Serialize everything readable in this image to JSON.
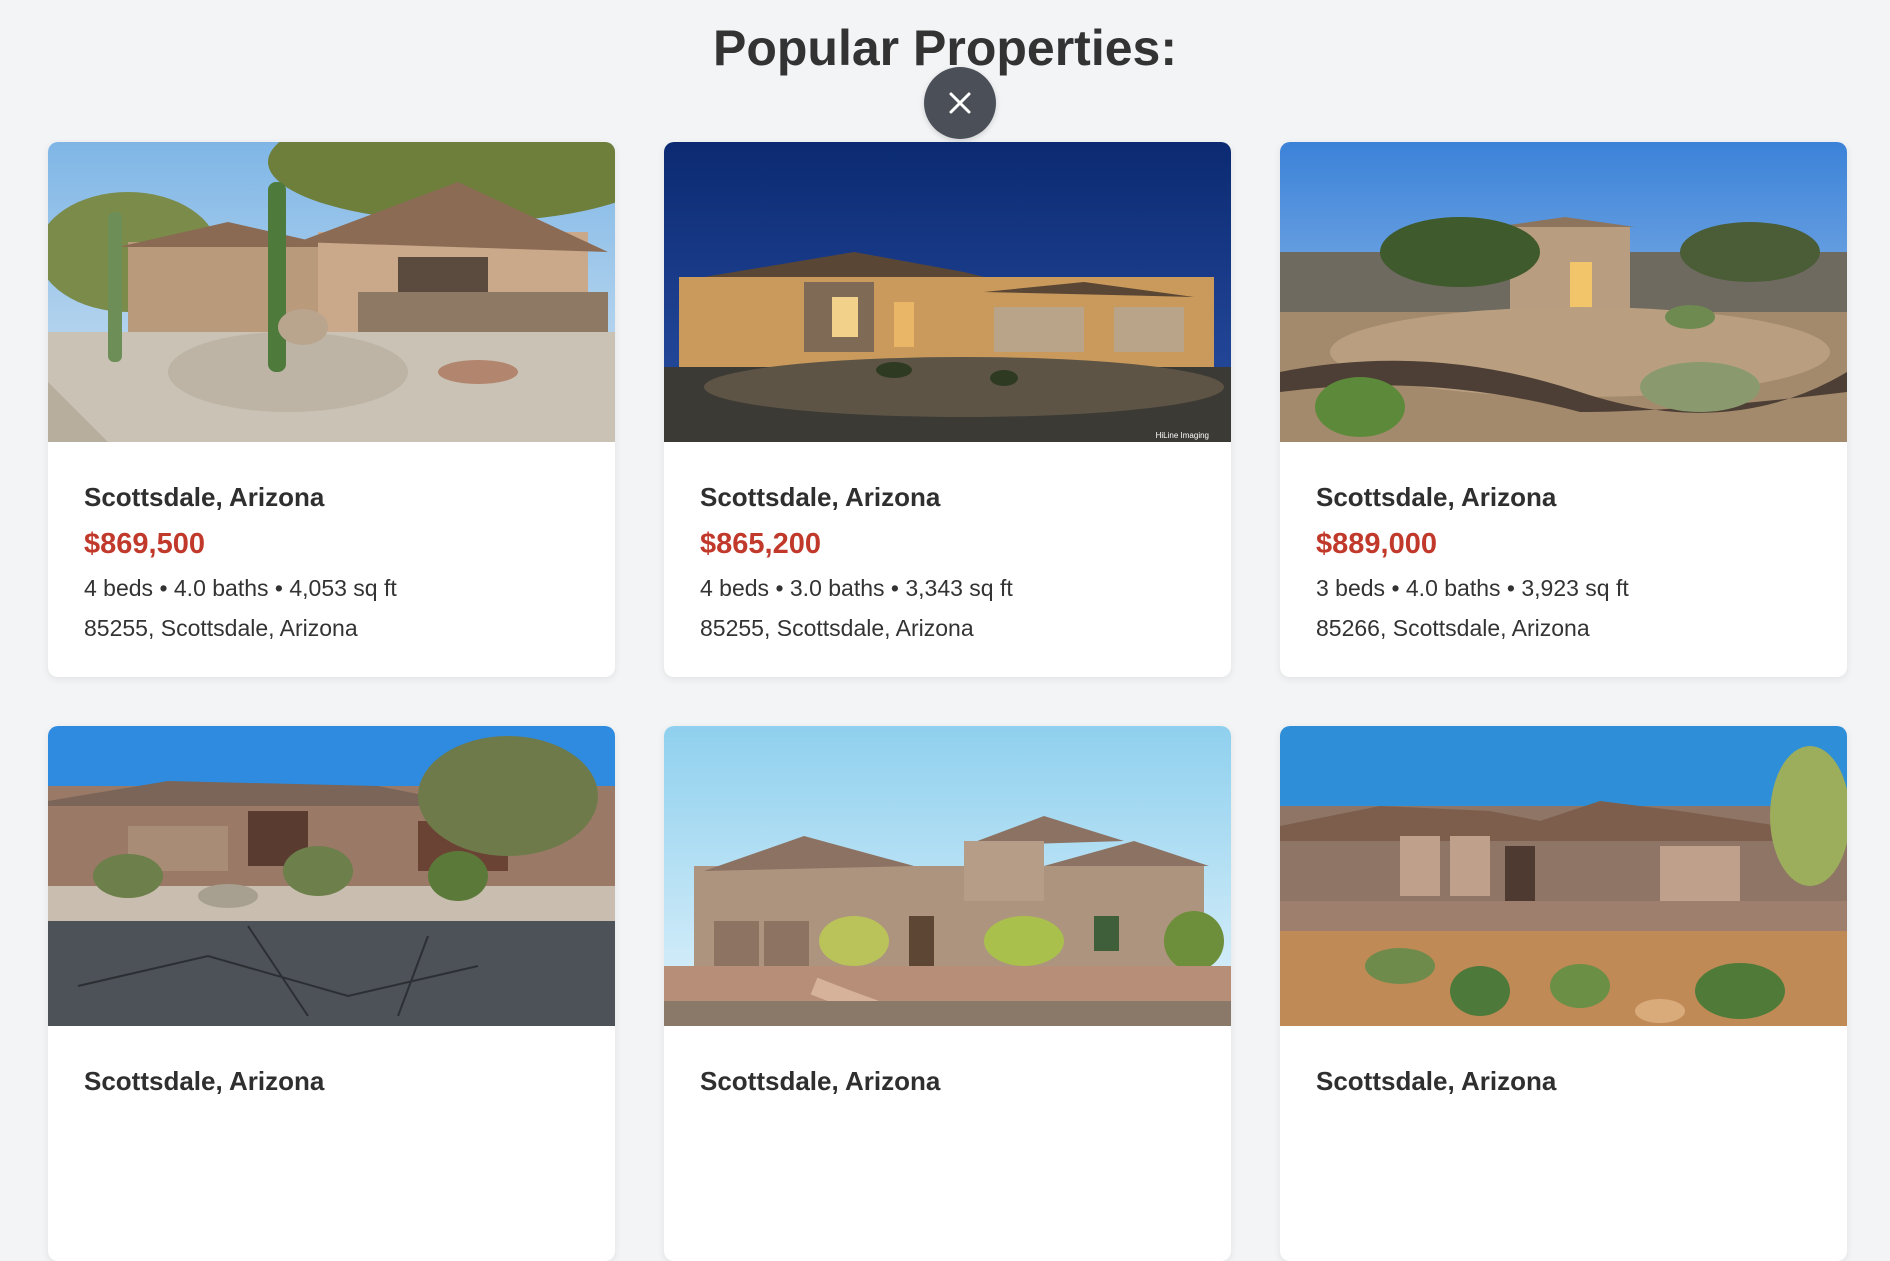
{
  "page": {
    "title": "Popular Properties:"
  },
  "close_button": {
    "icon": "close-icon"
  },
  "colors": {
    "background": "#f3f4f6",
    "price": "#c0392b",
    "close_button_bg": "#4b5058"
  },
  "properties": [
    {
      "city": "Scottsdale, Arizona",
      "price": "$869,500",
      "specs": "4 beds • 4.0 baths • 4,053 sq ft",
      "address": "85255, Scottsdale, Arizona"
    },
    {
      "city": "Scottsdale, Arizona",
      "price": "$865,200",
      "specs": "4 beds • 3.0 baths • 3,343 sq ft",
      "address": "85255, Scottsdale, Arizona",
      "photo_credit": "HiLine Imaging"
    },
    {
      "city": "Scottsdale, Arizona",
      "price": "$889,000",
      "specs": "3 beds • 4.0 baths • 3,923 sq ft",
      "address": "85266, Scottsdale, Arizona"
    },
    {
      "city": "Scottsdale, Arizona"
    },
    {
      "city": "Scottsdale, Arizona"
    },
    {
      "city": "Scottsdale, Arizona"
    }
  ]
}
